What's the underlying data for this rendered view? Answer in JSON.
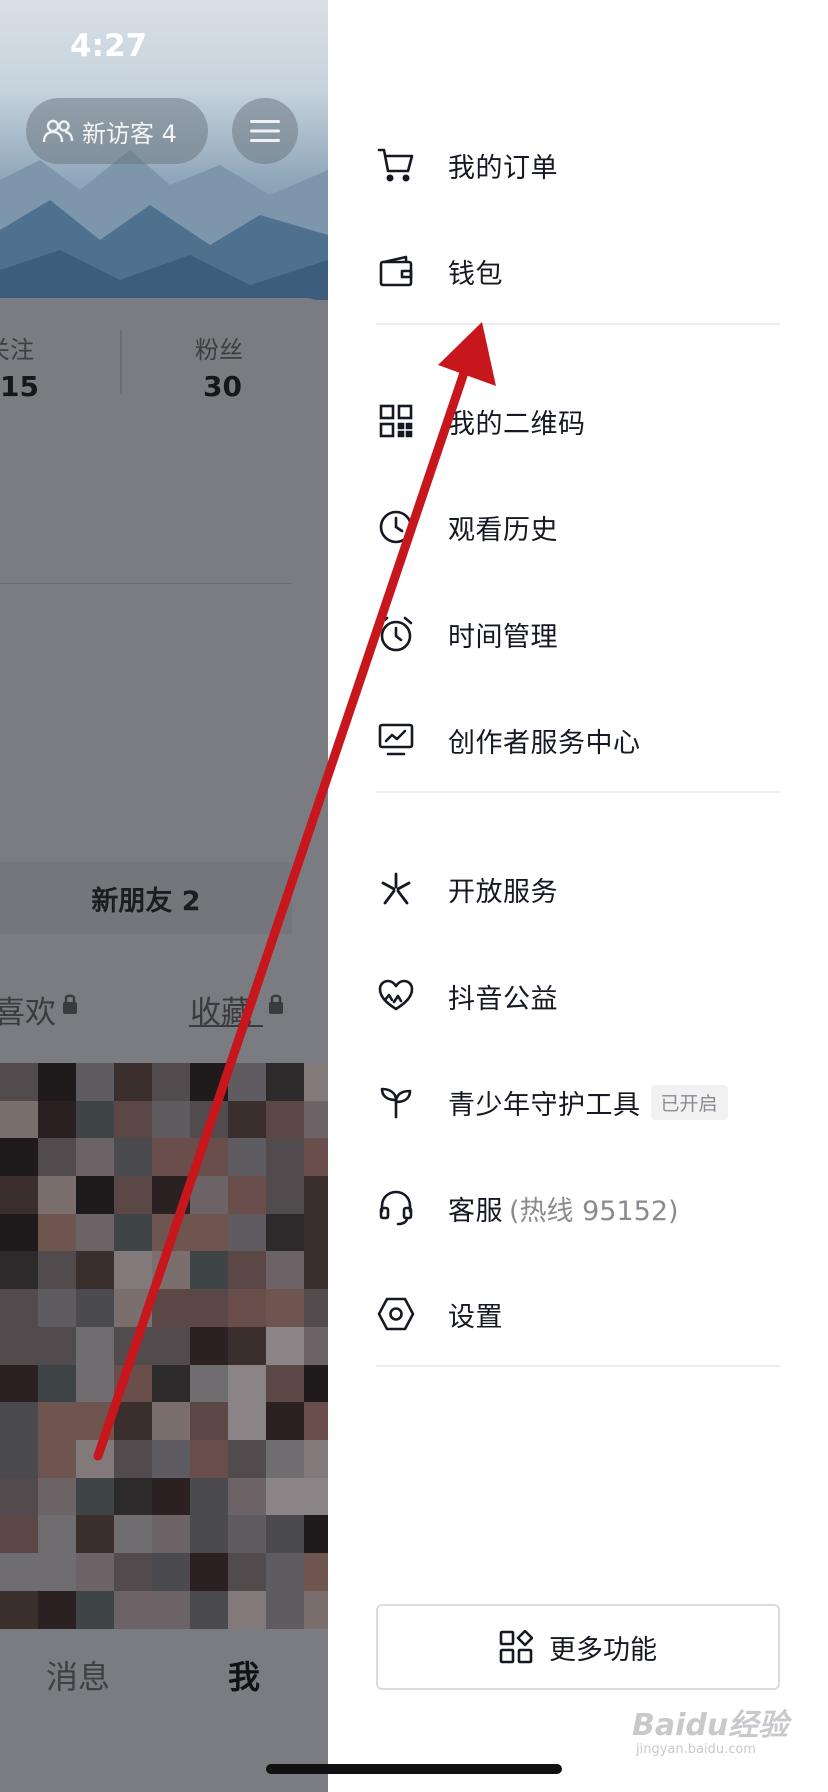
{
  "status_bar": {
    "time": "4:27"
  },
  "profile": {
    "visitor_label": "新访客 4",
    "stats": [
      {
        "label": "关注",
        "value": "15"
      },
      {
        "label": "粉丝",
        "value": "30"
      }
    ],
    "new_friends": "新朋友 2",
    "tabs": [
      {
        "label": "喜欢"
      },
      {
        "label": "收藏"
      }
    ],
    "bottom_nav": [
      {
        "label": "消息"
      },
      {
        "label": "我"
      }
    ]
  },
  "drawer": {
    "items": [
      {
        "label": "我的订单",
        "icon": "cart-icon"
      },
      {
        "label": "钱包",
        "icon": "wallet-icon"
      },
      {
        "label": "我的二维码",
        "icon": "qrcode-icon"
      },
      {
        "label": "观看历史",
        "icon": "history-clock-icon"
      },
      {
        "label": "时间管理",
        "icon": "alarm-clock-icon"
      },
      {
        "label": "创作者服务中心",
        "icon": "creator-monitor-icon"
      },
      {
        "label": "开放服务",
        "icon": "open-service-icon"
      },
      {
        "label": "抖音公益",
        "icon": "charity-heart-icon"
      },
      {
        "label": "青少年守护工具",
        "icon": "sprout-icon",
        "badge": "已开启"
      },
      {
        "label": "客服",
        "sublabel": "(热线 95152)",
        "icon": "headset-icon"
      },
      {
        "label": "设置",
        "icon": "settings-hex-icon"
      }
    ],
    "more_button": "更多功能"
  },
  "watermark": {
    "text": "Baidu经验",
    "sub": "jingyan.baidu.com"
  },
  "colors": {
    "annotation_arrow": "#c8161d",
    "overlay": "#7b7c81",
    "text_primary": "#161823",
    "text_secondary": "#8a8b91"
  }
}
